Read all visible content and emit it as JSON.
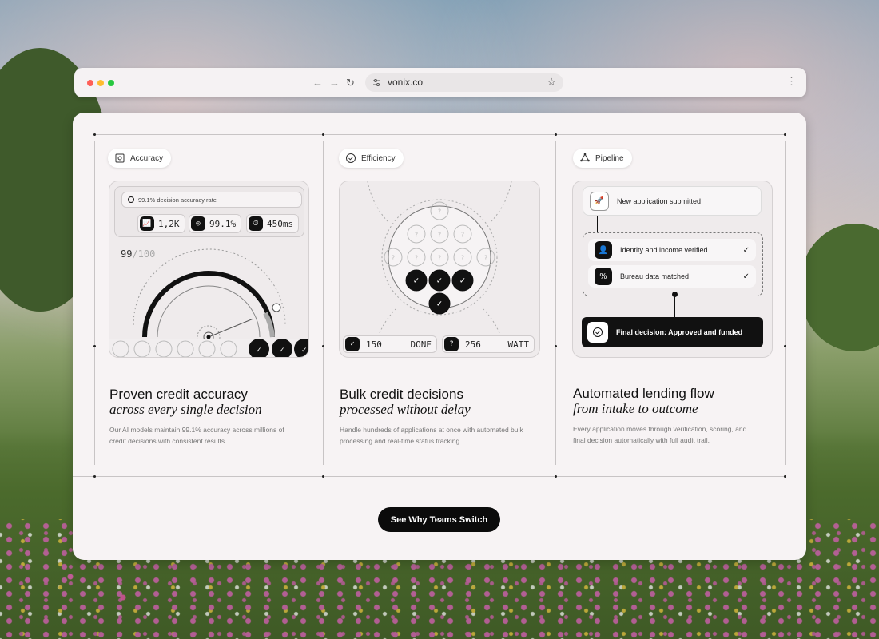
{
  "browser": {
    "url": "vonix.co",
    "traffic_lights": {
      "close": "#ff5f57",
      "minimize": "#febc2e",
      "maximize": "#28c840"
    }
  },
  "accuracy": {
    "tag": "Accuracy",
    "rate_label": "99.1% decision accuracy rate",
    "stats": [
      {
        "icon": "chart-icon",
        "value": "1,2K"
      },
      {
        "icon": "target-icon",
        "value": "99.1%"
      },
      {
        "icon": "timer-icon",
        "value": "450ms"
      }
    ],
    "score_value": "99",
    "score_total": "/100",
    "gauge_level": 0.99,
    "title": "Proven credit accuracy",
    "subtitle": "across every single decision",
    "description": "Our AI models maintain 99.1% accuracy across millions of credit decisions with consistent results."
  },
  "efficiency": {
    "tag": "Efficiency",
    "done_count": "150",
    "done_label": "DONE",
    "wait_count": "256",
    "wait_label": "WAIT",
    "title": "Bulk credit decisions",
    "subtitle": "processed without delay",
    "description": "Handle hundreds of applications at once with automated bulk processing and real-time status tracking."
  },
  "pipeline": {
    "tag": "Pipeline",
    "steps": [
      {
        "label": "New application submitted",
        "icon": "rocket-icon"
      },
      {
        "label": "Identity and income verified",
        "icon": "user-icon",
        "checked": true
      },
      {
        "label": "Bureau data matched",
        "icon": "percent-icon",
        "checked": true
      }
    ],
    "final": "Final decision: Approved and funded",
    "title": "Automated lending flow",
    "subtitle": "from intake to outcome",
    "description": "Every application moves through verification, scoring, and final decision automatically with full audit trail."
  },
  "cta": {
    "label": "See Why Teams Switch"
  }
}
